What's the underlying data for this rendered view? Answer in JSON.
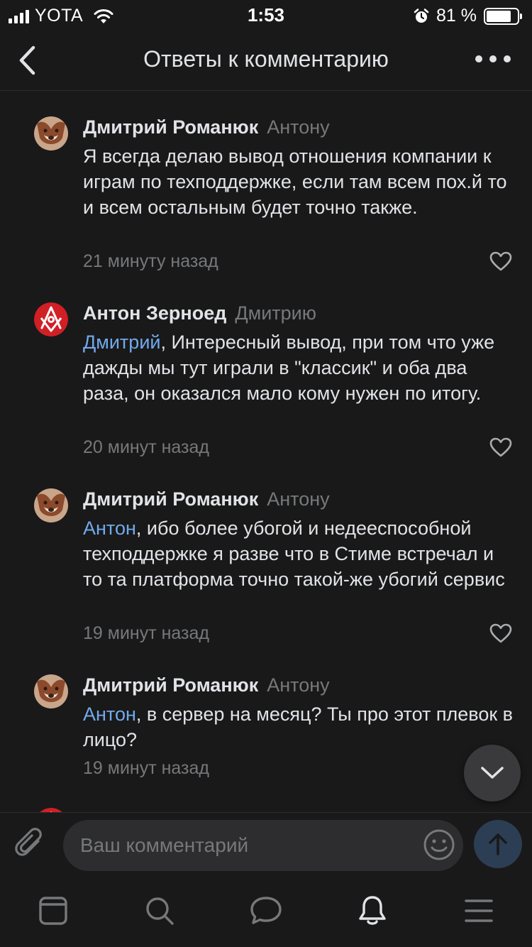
{
  "status_bar": {
    "carrier": "YOTA",
    "time": "1:53",
    "battery_percent": "81 %",
    "battery_level": 0.81,
    "signal_bars": 4
  },
  "nav": {
    "title": "Ответы к комментарию"
  },
  "comments": [
    {
      "author": "Дмитрий Романюк",
      "reply_to": "Антону",
      "mention": "",
      "text": "Я всегда делаю вывод отношения компании к играм по техподдержке, если там всем пох.й то и всем остальным будет точно также.",
      "time": "21 минуту назад",
      "avatar_icon": "fox-avatar"
    },
    {
      "author": "Антон Зерноед",
      "reply_to": "Дмитрию",
      "mention": "Дмитрий",
      "text": ", Интересный вывод, при том что уже дажды мы тут играли в \"классик\" и оба два раза, он оказался мало кому нужен по итогу.",
      "time": "20 минут назад",
      "avatar_icon": "masonic-emblem-avatar"
    },
    {
      "author": "Дмитрий Романюк",
      "reply_to": "Антону",
      "mention": "Антон",
      "text": ", ибо более убогой и недееспособной техподдержке я разве что в Стиме встречал и то та платформа точно такой-же убогий сервис",
      "time": "19 минут назад",
      "avatar_icon": "fox-avatar"
    },
    {
      "author": "Дмитрий Романюк",
      "reply_to": "Антону",
      "mention": "Антон",
      "text": ", в сервер на месяц? Ты про этот плевок в лицо?",
      "time": "19 минут назад",
      "avatar_icon": "fox-avatar"
    }
  ],
  "compose": {
    "placeholder": "Ваш комментарий"
  },
  "colors": {
    "background": "#19191a",
    "text": "#e1e3e6",
    "secondary_text": "#76787a",
    "link": "#71aaeb",
    "input_bg": "#2d2d2f",
    "send_button": "#2c3e54"
  },
  "tabs": [
    {
      "icon": "newsfeed-icon"
    },
    {
      "icon": "search-icon"
    },
    {
      "icon": "messages-icon"
    },
    {
      "icon": "notifications-bell-icon"
    },
    {
      "icon": "menu-icon"
    }
  ]
}
